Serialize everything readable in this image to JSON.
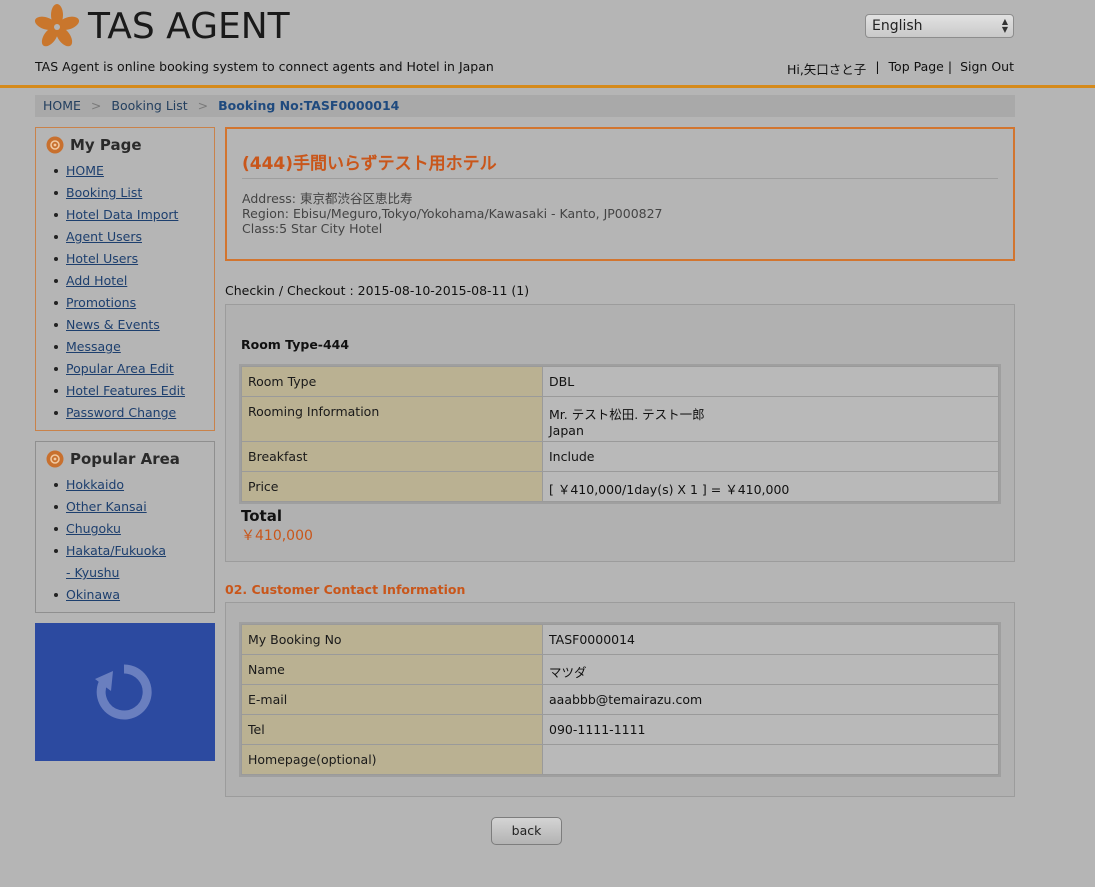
{
  "header": {
    "logo_text": "TAS AGENT",
    "tagline": "TAS Agent is online booking system to connect agents and Hotel in Japan",
    "language": "English",
    "greeting": "Hi,矢口さと子",
    "top_page": "Top Page",
    "sign_out": "Sign Out"
  },
  "breadcrumb": {
    "home": "HOME",
    "booking_list": "Booking List",
    "current": "Booking No:TASF0000014",
    "separator": ">"
  },
  "sidebar": {
    "mypage_title": "My Page",
    "mypage_items": [
      "HOME",
      "Booking List",
      "Hotel Data Import",
      "Agent Users",
      "Hotel Users",
      "Add Hotel",
      "Promotions",
      "News & Events",
      "Message",
      "Popular Area Edit",
      "Hotel Features Edit",
      "Password Change"
    ],
    "popular_title": "Popular Area",
    "popular_items": [
      "Hokkaido",
      "Other Kansai",
      "Chugoku",
      "Hakata/Fukuoka - Kyushu",
      "Okinawa"
    ]
  },
  "hotel": {
    "name": "(444)手間いらずテスト用ホテル",
    "address": "Address: 東京都渋谷区恵比寿",
    "region": "Region: Ebisu/Meguro,Tokyo/Yokohama/Kawasaki - Kanto, JP000827",
    "class": "Class:5 Star City Hotel"
  },
  "checkin": "Checkin / Checkout : 2015-08-10-2015-08-11 (1)",
  "room": {
    "title": "Room Type-444",
    "rows": [
      {
        "label": "Room Type",
        "value": "DBL"
      },
      {
        "label": "Rooming Information",
        "value": "Mr. テスト松田. テスト一郎",
        "value2": "Japan"
      },
      {
        "label": "Breakfast",
        "value": "Include"
      },
      {
        "label": "Price",
        "value": "[ ￥410,000/1day(s) X 1 ] = ￥410,000"
      }
    ],
    "total_label": "Total",
    "total_value": "￥410,000"
  },
  "contact": {
    "title": "02. Customer Contact Information",
    "rows": [
      {
        "label": "My Booking No",
        "value": "TASF0000014"
      },
      {
        "label": "Name",
        "value": "マツダ"
      },
      {
        "label": "E-mail",
        "value": "aaabbb@temairazu.com"
      },
      {
        "label": "Tel",
        "value": "090-1111-1111"
      },
      {
        "label": "Homepage(optional)",
        "value": ""
      }
    ]
  },
  "back_button": "back",
  "colors": {
    "accent": "#d2752f",
    "header_rule": "#d58a1b",
    "ad_box": "#2c4aa0"
  }
}
